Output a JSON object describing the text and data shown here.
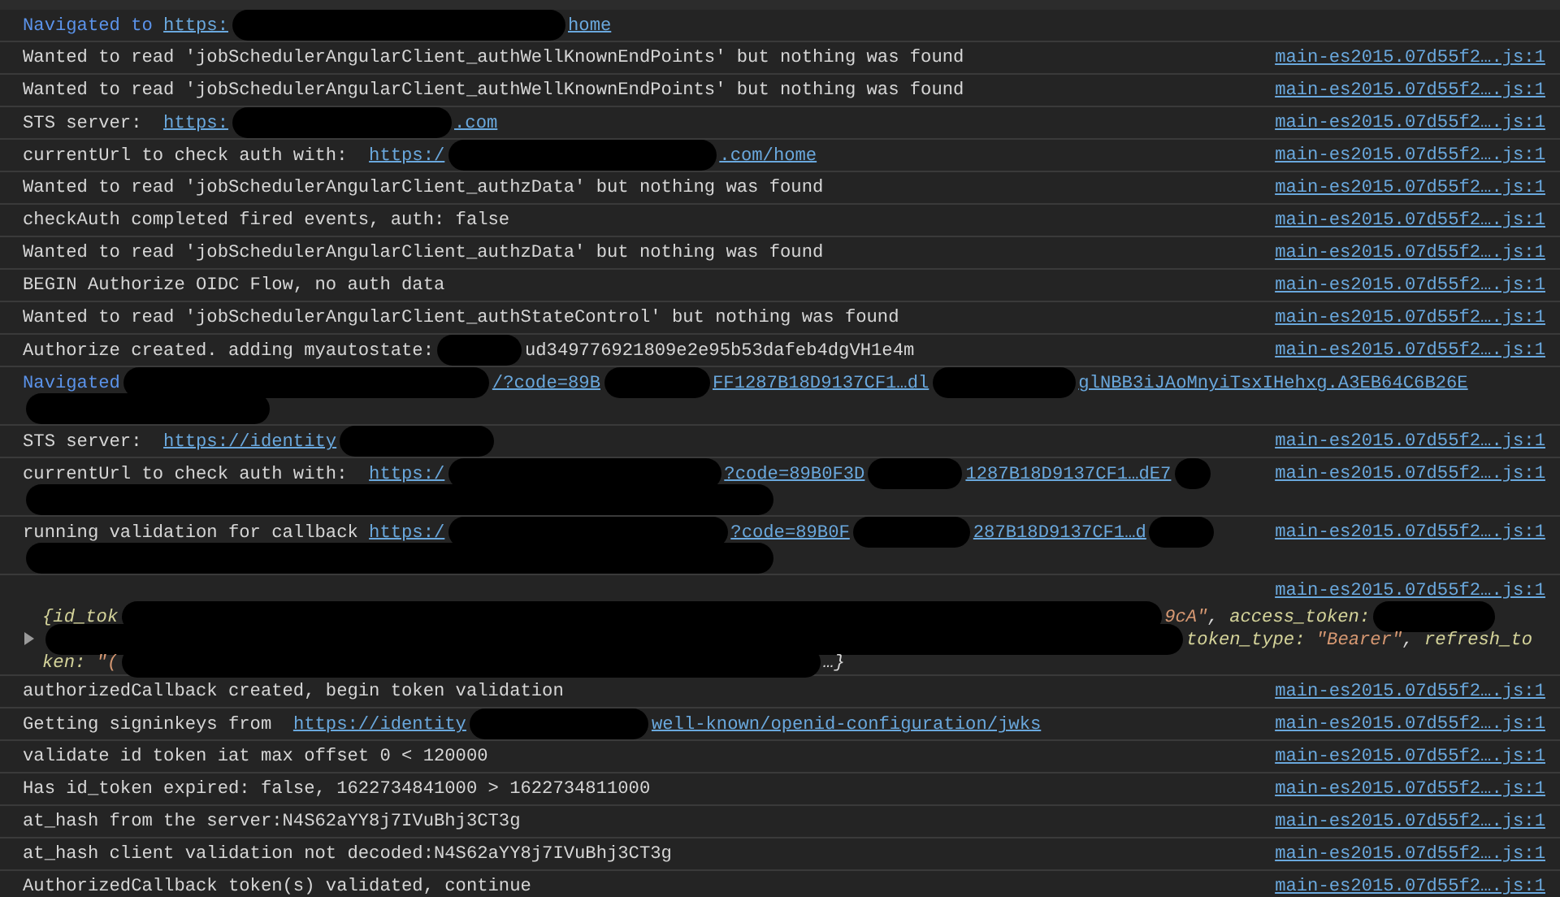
{
  "console": {
    "messages": [
      {
        "kind": "navigation",
        "segments": [
          {
            "kind": "text",
            "text": "Navigated to "
          },
          {
            "kind": "link",
            "text": "https:"
          },
          {
            "kind": "redaction"
          },
          {
            "kind": "link",
            "text": "home"
          }
        ]
      },
      {
        "kind": "log",
        "segments": [
          {
            "kind": "text",
            "text": "Wanted to read 'jobSchedulerAngularClient_authWellKnownEndPoints' but nothing was found"
          }
        ],
        "source": "main-es2015.07d55f2….js:1"
      },
      {
        "kind": "log",
        "segments": [
          {
            "kind": "text",
            "text": "Wanted to read 'jobSchedulerAngularClient_authWellKnownEndPoints' but nothing was found"
          }
        ],
        "source": "main-es2015.07d55f2….js:1"
      },
      {
        "kind": "log",
        "segments": [
          {
            "kind": "text",
            "text": "STS server:  "
          },
          {
            "kind": "link",
            "text": "https:"
          },
          {
            "kind": "redaction"
          },
          {
            "kind": "link",
            "text": ".com"
          }
        ],
        "source": "main-es2015.07d55f2….js:1"
      },
      {
        "kind": "log",
        "segments": [
          {
            "kind": "text",
            "text": "currentUrl to check auth with:  "
          },
          {
            "kind": "link",
            "text": "https:/"
          },
          {
            "kind": "redaction"
          },
          {
            "kind": "link",
            "text": ".com/home"
          }
        ],
        "source": "main-es2015.07d55f2….js:1"
      },
      {
        "kind": "log",
        "segments": [
          {
            "kind": "text",
            "text": "Wanted to read 'jobSchedulerAngularClient_authzData' but nothing was found"
          }
        ],
        "source": "main-es2015.07d55f2….js:1"
      },
      {
        "kind": "log",
        "segments": [
          {
            "kind": "text",
            "text": "checkAuth completed fired events, auth: false"
          }
        ],
        "source": "main-es2015.07d55f2….js:1"
      },
      {
        "kind": "log",
        "segments": [
          {
            "kind": "text",
            "text": "Wanted to read 'jobSchedulerAngularClient_authzData' but nothing was found"
          }
        ],
        "source": "main-es2015.07d55f2….js:1"
      },
      {
        "kind": "log",
        "segments": [
          {
            "kind": "text",
            "text": "BEGIN Authorize OIDC Flow, no auth data"
          }
        ],
        "source": "main-es2015.07d55f2….js:1"
      },
      {
        "kind": "log",
        "segments": [
          {
            "kind": "text",
            "text": "Wanted to read 'jobSchedulerAngularClient_authStateControl' but nothing was found"
          }
        ],
        "source": "main-es2015.07d55f2….js:1"
      },
      {
        "kind": "log",
        "segments": [
          {
            "kind": "text",
            "text": "Authorize created. adding myautostate:"
          },
          {
            "kind": "redaction"
          },
          {
            "kind": "text",
            "text": "ud349776921809e2e95b53dafeb4dgVH1e4m"
          }
        ],
        "source": "main-es2015.07d55f2….js:1"
      },
      {
        "kind": "navigation",
        "segments": [
          {
            "kind": "text",
            "text": "Navigated"
          },
          {
            "kind": "redaction"
          },
          {
            "kind": "link",
            "text": "/?code=89B"
          },
          {
            "kind": "redaction"
          },
          {
            "kind": "link",
            "text": "FF1287B18D9137CF1…dl"
          },
          {
            "kind": "redaction"
          },
          {
            "kind": "link",
            "text": "glNBB3iJAoMnyiTsxIHehxg.A3EB64C6B26E"
          },
          {
            "kind": "break"
          },
          {
            "kind": "redaction"
          }
        ]
      },
      {
        "kind": "log",
        "segments": [
          {
            "kind": "text",
            "text": "STS server:  "
          },
          {
            "kind": "link",
            "text": "https://identity"
          },
          {
            "kind": "redaction"
          }
        ],
        "source": "main-es2015.07d55f2….js:1"
      },
      {
        "kind": "log",
        "segments": [
          {
            "kind": "text",
            "text": "currentUrl to check auth with:  "
          },
          {
            "kind": "link",
            "text": "https:/"
          },
          {
            "kind": "redaction"
          },
          {
            "kind": "link",
            "text": "?code=89B0F3D"
          },
          {
            "kind": "redaction"
          },
          {
            "kind": "link",
            "text": "1287B18D9137CF1…dE7"
          },
          {
            "kind": "redaction"
          },
          {
            "kind": "break"
          },
          {
            "kind": "redaction"
          }
        ],
        "source": "main-es2015.07d55f2….js:1"
      },
      {
        "kind": "log",
        "segments": [
          {
            "kind": "text",
            "text": "running validation for callback "
          },
          {
            "kind": "link",
            "text": "https:/"
          },
          {
            "kind": "redaction"
          },
          {
            "kind": "link",
            "text": "?code=89B0F"
          },
          {
            "kind": "redaction"
          },
          {
            "kind": "link",
            "text": "287B18D9137CF1…d"
          },
          {
            "kind": "redaction"
          },
          {
            "kind": "break"
          },
          {
            "kind": "redaction"
          }
        ],
        "source": "main-es2015.07d55f2….js:1"
      },
      {
        "kind": "object",
        "expanded": false,
        "source": "main-es2015.07d55f2….js:1",
        "lines": [
          [
            {
              "kind": "key",
              "text": "{id_tok"
            },
            {
              "kind": "redaction"
            },
            {
              "kind": "string",
              "text": "9cA\""
            },
            {
              "kind": "punct",
              "text": ", "
            },
            {
              "kind": "key",
              "text": "access_token:"
            },
            {
              "kind": "redaction"
            }
          ],
          [
            {
              "kind": "redaction"
            },
            {
              "kind": "key",
              "text": "token_type: "
            },
            {
              "kind": "string",
              "text": "\"Bearer\""
            },
            {
              "kind": "punct",
              "text": ", "
            },
            {
              "kind": "key",
              "text": "refresh_to"
            }
          ],
          [
            {
              "kind": "key",
              "text": "ken: "
            },
            {
              "kind": "string",
              "text": "\"("
            },
            {
              "kind": "redaction"
            },
            {
              "kind": "punct",
              "text": "…}"
            }
          ]
        ]
      },
      {
        "kind": "log",
        "segments": [
          {
            "kind": "text",
            "text": "authorizedCallback created, begin token validation"
          }
        ],
        "source": "main-es2015.07d55f2….js:1"
      },
      {
        "kind": "log",
        "segments": [
          {
            "kind": "text",
            "text": "Getting signinkeys from  "
          },
          {
            "kind": "link",
            "text": "https://identity"
          },
          {
            "kind": "redaction"
          },
          {
            "kind": "link",
            "text": "well-known/openid-configuration/jwks"
          }
        ],
        "source": "main-es2015.07d55f2….js:1"
      },
      {
        "kind": "log",
        "segments": [
          {
            "kind": "text",
            "text": "validate id token iat max offset 0 < 120000"
          }
        ],
        "source": "main-es2015.07d55f2….js:1"
      },
      {
        "kind": "log",
        "segments": [
          {
            "kind": "text",
            "text": "Has id_token expired: false, 1622734841000 > 1622734811000"
          }
        ],
        "source": "main-es2015.07d55f2….js:1"
      },
      {
        "kind": "log",
        "segments": [
          {
            "kind": "text",
            "text": "at_hash from the server:N4S62aYY8j7IVuBhj3CT3g"
          }
        ],
        "source": "main-es2015.07d55f2….js:1"
      },
      {
        "kind": "log",
        "segments": [
          {
            "kind": "text",
            "text": "at_hash client validation not decoded:N4S62aYY8j7IVuBhj3CT3g"
          }
        ],
        "source": "main-es2015.07d55f2….js:1"
      },
      {
        "kind": "log",
        "segments": [
          {
            "kind": "text",
            "text": "AuthorizedCallback token(s) validated, continue"
          }
        ],
        "source": "main-es2015.07d55f2….js:1"
      }
    ]
  }
}
